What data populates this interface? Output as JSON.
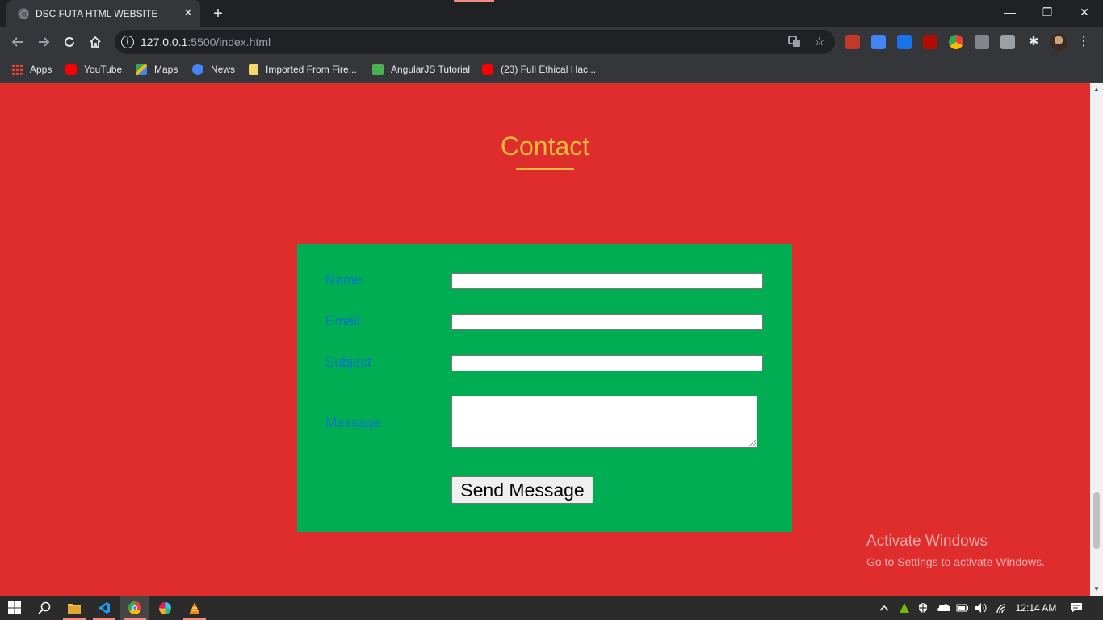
{
  "browser": {
    "tab_title": "DSC FUTA HTML WEBSITE",
    "tab_close_glyph": "✕",
    "new_tab_glyph": "+",
    "url_host": "127.0.0.1",
    "url_rest": ":5500/index.html",
    "window_controls": {
      "minimize": "—",
      "restore": "❐",
      "close": "✕"
    },
    "nav_icons": [
      "back-icon",
      "forward-icon",
      "reload-icon",
      "home-icon"
    ],
    "kebab_glyph": "⋮"
  },
  "bookmarks": [
    {
      "label": "Apps",
      "icon": "apps-grid-icon",
      "color": "#ea4335"
    },
    {
      "label": "YouTube",
      "icon": "youtube-icon",
      "color": "#ff0000"
    },
    {
      "label": "Maps",
      "icon": "maps-icon",
      "color": "#34a853"
    },
    {
      "label": "News",
      "icon": "news-icon",
      "color": "#4285f4"
    },
    {
      "label": "Imported From Fire...",
      "icon": "folder-icon",
      "color": "#f9d56e"
    },
    {
      "label": "AngularJS Tutorial",
      "icon": "w3schools-icon",
      "color": "#4caf50"
    },
    {
      "label": "(23) Full Ethical Hac...",
      "icon": "youtube-icon",
      "color": "#ff0000"
    }
  ],
  "page": {
    "contact_heading": "Contact",
    "form": {
      "name_label": "Name",
      "email_label": "Email",
      "subject_label": "Subject",
      "message_label": "Message",
      "name_value": "",
      "email_value": "",
      "subject_value": "",
      "message_value": "",
      "send_button": "Send Message"
    },
    "colors": {
      "background": "#df2c2c",
      "heading": "#f4b93a",
      "form_panel": "#00ad52",
      "label": "#0a76c8"
    }
  },
  "watermark": {
    "line1": "Activate Windows",
    "line2": "Go to Settings to activate Windows."
  },
  "taskbar": {
    "time": "12:14 AM",
    "apps": [
      "windows-start-icon",
      "search-icon",
      "file-explorer-icon",
      "vscode-icon",
      "chrome-icon",
      "slack-icon",
      "vlc-icon"
    ],
    "tray": [
      "chevron-up-icon",
      "nvidia-icon",
      "defender-icon",
      "onedrive-icon",
      "battery-icon",
      "volume-icon",
      "wifi-icon",
      "notification-icon"
    ]
  }
}
